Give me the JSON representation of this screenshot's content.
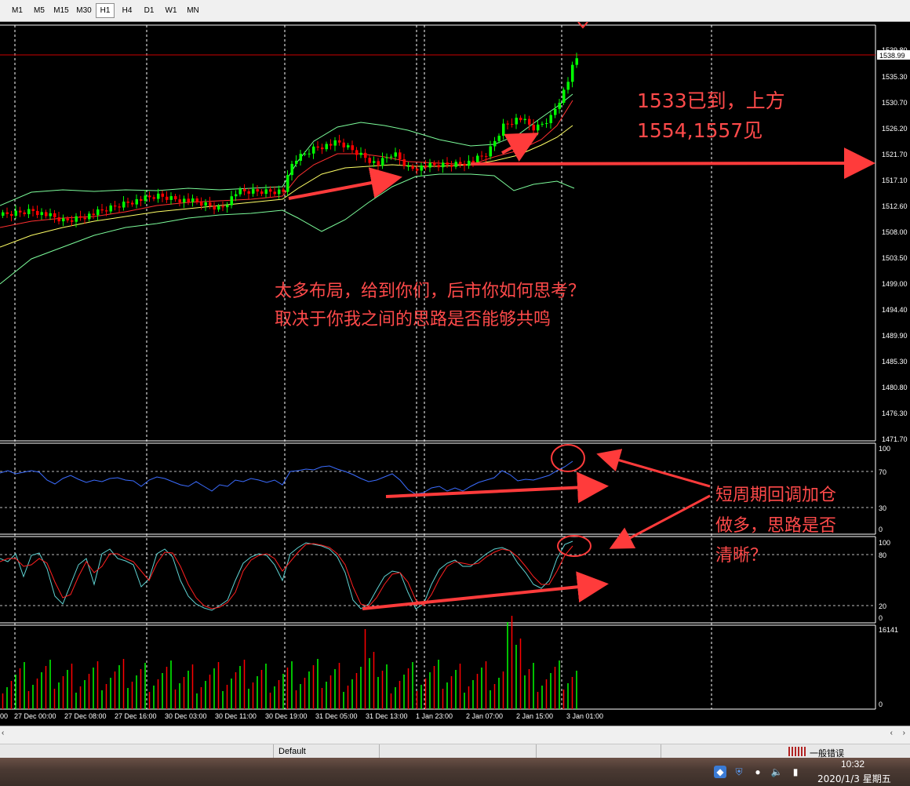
{
  "toolbar": {
    "timeframes": [
      "M1",
      "M5",
      "M15",
      "M30",
      "H1",
      "H4",
      "D1",
      "W1",
      "MN"
    ],
    "active": "H1"
  },
  "price_axis": {
    "current_price": "1538.99",
    "top_partial": "1539.80",
    "labels": [
      "1535.30",
      "1530.70",
      "1526.20",
      "1521.70",
      "1517.10",
      "1512.60",
      "1508.00",
      "1503.50",
      "1499.00",
      "1494.40",
      "1489.90",
      "1485.30",
      "1480.80",
      "1476.30",
      "1471.70"
    ]
  },
  "indicator1_levels": [
    "100",
    "70",
    "30",
    "0"
  ],
  "indicator2_levels": [
    "100",
    "80",
    "20",
    "0"
  ],
  "volume_levels": [
    "16141",
    "0"
  ],
  "time_axis": [
    "00",
    "27 Dec 00:00",
    "27 Dec 08:00",
    "27 Dec 16:00",
    "30 Dec 03:00",
    "30 Dec 11:00",
    "30 Dec 19:00",
    "31 Dec 05:00",
    "31 Dec 13:00",
    "1 Jan 23:00",
    "2 Jan 07:00",
    "2 Jan 15:00",
    "3 Jan 01:00"
  ],
  "annotations": {
    "target_line1": "1533已到，上方",
    "target_line2": "1554,1557见",
    "middle_line1": "太多布局，给到你们，后市你如何思考？",
    "middle_line2": "取决于你我之间的思路是否能够共鸣",
    "right_line1": "短周期回调加仓",
    "right_line2": "做多，思路是否",
    "right_line3": "清晰？"
  },
  "status": {
    "profile": "Default",
    "error_text": "一般错误"
  },
  "taskbar": {
    "time": "10:32",
    "date": "2020/1/3 星期五"
  },
  "colors": {
    "bull": "#00ff00",
    "bear": "#ff0000",
    "annotation": "#ff4a4a",
    "bollinger": "#7CFC9A",
    "ma_fast": "#ff3030",
    "ma_slow": "#ffff66",
    "rsi": "#3b6cff",
    "stoch_main": "#5fd3d3",
    "stoch_signal": "#ff2020"
  }
}
